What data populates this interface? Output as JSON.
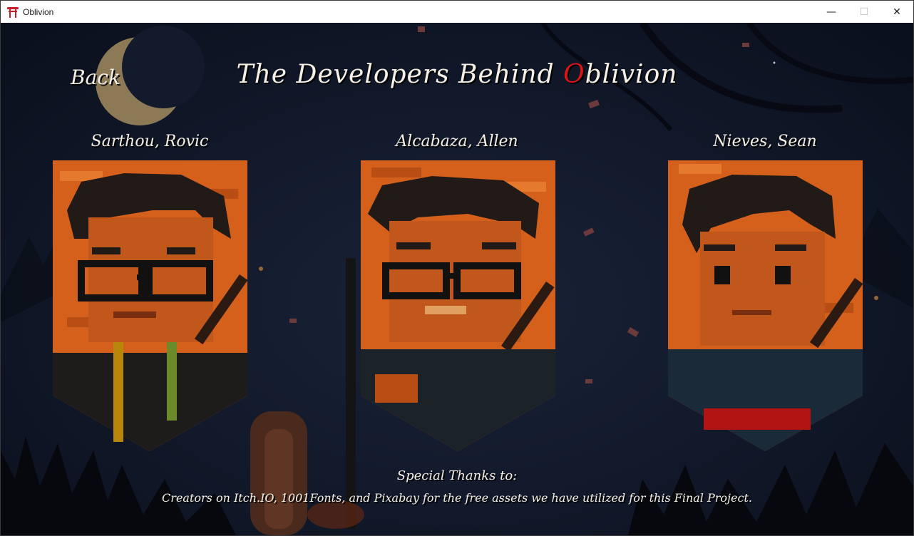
{
  "window": {
    "title": "Oblivion",
    "minimize_glyph": "—",
    "maximize_glyph": "☐",
    "close_glyph": "✕"
  },
  "scene": {
    "back_label": "Back",
    "title_prefix": "The Developers Behind ",
    "title_accent": "O",
    "title_rest": "blivion",
    "accent_color": "#e01414"
  },
  "developers": [
    {
      "name": "Sarthou, Rovic"
    },
    {
      "name": "Alcabaza, Allen"
    },
    {
      "name": "Nieves, Sean"
    }
  ],
  "credits": {
    "heading": "Special Thanks to:",
    "body": "Creators on Itch.IO, 1001Fonts, and Pixabay for the free assets we have utilized for this Final Project."
  },
  "icons": {
    "app": "torii-gate-icon",
    "moon": "crescent-moon-icon"
  }
}
